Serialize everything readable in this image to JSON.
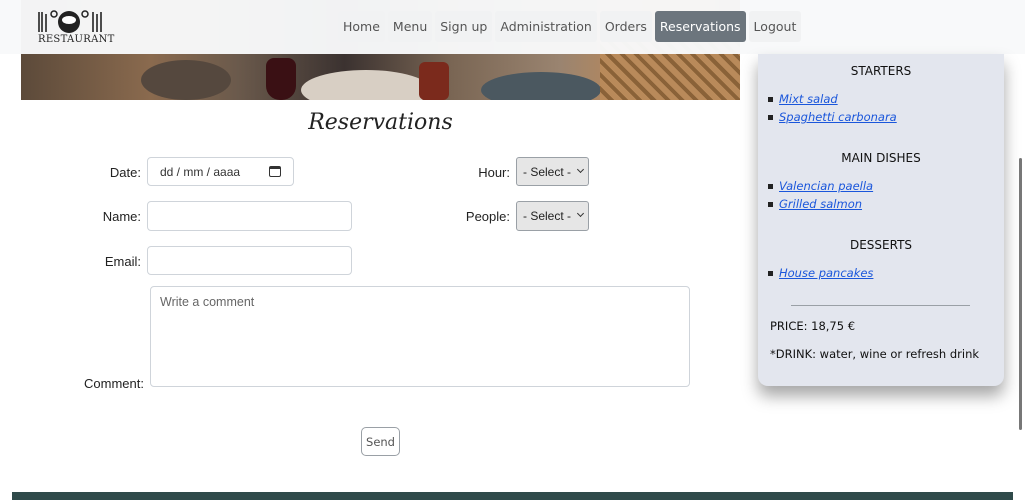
{
  "brand": {
    "logo_text": "RESTAURANT"
  },
  "nav": {
    "items": [
      {
        "label": "Home"
      },
      {
        "label": "Menu"
      },
      {
        "label": "Sign up"
      },
      {
        "label": "Administration"
      },
      {
        "label": "Orders"
      },
      {
        "label": "Reservations",
        "active": true
      },
      {
        "label": "Logout"
      }
    ]
  },
  "page": {
    "title": "Reservations"
  },
  "form": {
    "date_label": "Date:",
    "date_placeholder": "dd / mm / aaaa",
    "hour_label": "Hour:",
    "hour_value": "- Select -",
    "name_label": "Name:",
    "name_value": "",
    "people_label": "People:",
    "people_value": "- Select -",
    "email_label": "Email:",
    "email_value": "",
    "comment_label": "Comment:",
    "comment_placeholder": "Write a comment",
    "send_label": "Send"
  },
  "menu_card": {
    "starters_title": "STARTERS",
    "starters": [
      "Mixt salad",
      "Spaghetti carbonara"
    ],
    "main_title": "MAIN DISHES",
    "mains": [
      "Valencian paella",
      "Grilled salmon"
    ],
    "desserts_title": "DESSERTS",
    "desserts": [
      "House pancakes"
    ],
    "price": "PRICE: 18,75 €",
    "drink": "*DRINK: water, wine or refresh drink"
  },
  "colors": {
    "active_nav": "#6c757d",
    "link": "#1a56db",
    "card_bg": "#e3e6ee",
    "footer": "#2f4a4a"
  }
}
